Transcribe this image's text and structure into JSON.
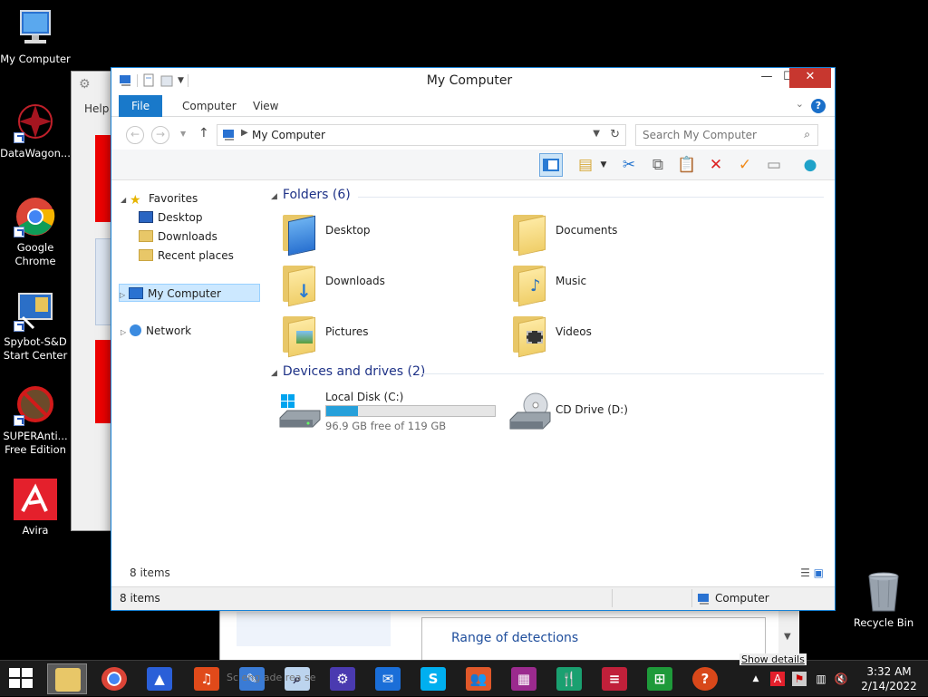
{
  "desktop": {
    "icons": [
      {
        "label": "My Computer"
      },
      {
        "label": "DataWagon..."
      },
      {
        "label": "Google Chrome"
      },
      {
        "label": "Spybot-S&D Start Center"
      },
      {
        "label": "SUPERAnti... Free Edition"
      },
      {
        "label": "Avira"
      }
    ],
    "recycle_bin": "Recycle Bin"
  },
  "background_windows": {
    "help_label": "Help",
    "detections_label": "Range of detections",
    "ghost_text": "Sc      eng     ade    rea    se"
  },
  "window": {
    "title": "My Computer",
    "minimize": "—",
    "maximize": "☐",
    "close": "✕",
    "ribbon_tabs": [
      "File",
      "Computer",
      "View"
    ],
    "address": "My Computer",
    "search_placeholder": "Search My Computer",
    "nav": {
      "favorites": "Favorites",
      "fav_items": [
        "Desktop",
        "Downloads",
        "Recent places"
      ],
      "my_computer": "My Computer",
      "network": "Network"
    },
    "folders_header": "Folders (6)",
    "folders": [
      "Desktop",
      "Documents",
      "Downloads",
      "Music",
      "Pictures",
      "Videos"
    ],
    "devices_header": "Devices and drives (2)",
    "drives": [
      {
        "name": "Local Disk (C:)",
        "free": "96.9 GB free of 119 GB",
        "used_fraction": 0.19
      },
      {
        "name": "CD Drive (D:)"
      }
    ],
    "item_count": "8 items",
    "status_left": "8 items",
    "status_right": "Computer"
  },
  "taskbar": {
    "show_details": "Show details",
    "time": "3:32 AM",
    "date": "2/14/2022",
    "colors": {
      "accent": "#1979ca",
      "close": "#c7372f"
    }
  }
}
